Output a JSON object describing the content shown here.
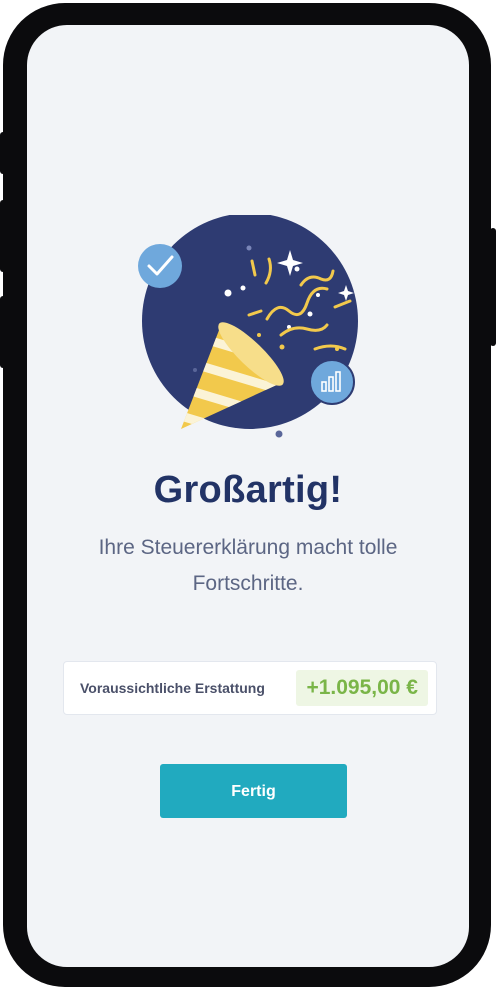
{
  "main": {
    "headline": "Großartig!",
    "subtitle_line1": "Ihre Steuererklärung macht tolle",
    "subtitle_line2": "Fortschritte."
  },
  "refund": {
    "label": "Voraussichtliche Erstattung",
    "amount": "+1.095,00 €"
  },
  "actions": {
    "done_label": "Fertig"
  },
  "colors": {
    "circle": "#2e3b72",
    "headline": "#223366",
    "accent_yellow": "#f2c94c",
    "badge_blue": "#6fa8dc",
    "button": "#21aabf",
    "amount_green": "#7ab548"
  },
  "icons": {
    "check_badge": "checkmark-icon",
    "chart_badge": "bar-chart-icon",
    "party_popper": "party-popper-icon"
  }
}
